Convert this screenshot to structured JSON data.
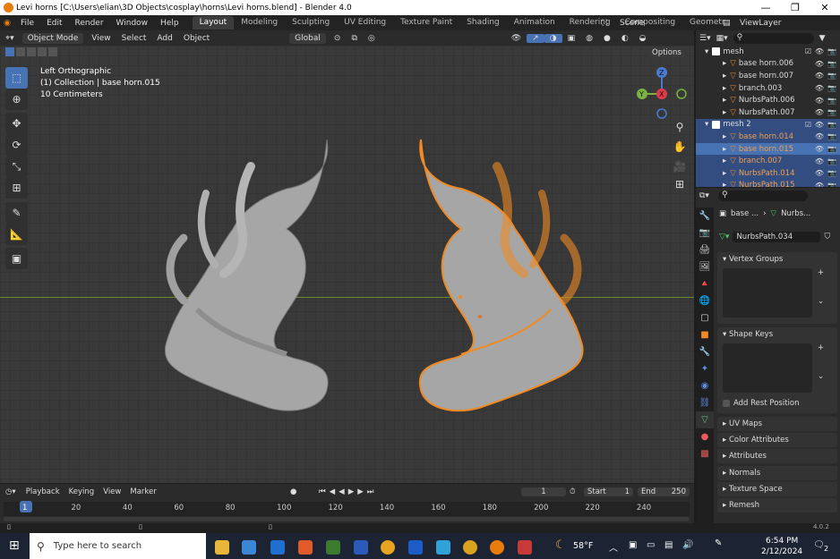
{
  "window": {
    "title": "Levi horns [C:\\Users\\elian\\3D Objects\\cosplay\\horns\\Levi horns.blend] - Blender 4.0"
  },
  "menu": [
    "File",
    "Edit",
    "Render",
    "Window",
    "Help"
  ],
  "workspaces": [
    "Layout",
    "Modeling",
    "Sculpting",
    "UV Editing",
    "Texture Paint",
    "Shading",
    "Animation",
    "Rendering",
    "Compositing",
    "Geometr"
  ],
  "scene": "Scene",
  "view_layer": "ViewLayer",
  "header": {
    "mode": "Object Mode",
    "view": "View",
    "select": "Select",
    "add": "Add",
    "object": "Object",
    "orientation": "Global",
    "options": "Options"
  },
  "viewport": {
    "line1": "Left Orthographic",
    "line2": "(1) Collection | base horn.015",
    "line3": "10 Centimeters"
  },
  "gizmo": {
    "z": "Z",
    "y": "Y",
    "x": "X"
  },
  "outliner": {
    "collections": [
      {
        "name": "mesh",
        "items": [
          "base horn.006",
          "base horn.007",
          "branch.003",
          "NurbsPath.006",
          "NurbsPath.007"
        ]
      },
      {
        "name": "mesh 2",
        "items": [
          "base horn.014",
          "base horn.015",
          "branch.007",
          "NurbsPath.014",
          "NurbsPath.015"
        ]
      }
    ]
  },
  "properties": {
    "breadcrumb1": "base ...",
    "breadcrumb2": "Nurbs...",
    "data_name": "NurbsPath.034",
    "vertex_groups": "Vertex Groups",
    "shape_keys": "Shape Keys",
    "add_rest": "Add Rest Position",
    "sections": [
      "UV Maps",
      "Color Attributes",
      "Attributes",
      "Normals",
      "Texture Space",
      "Remesh"
    ]
  },
  "timeline": {
    "playback": "Playback",
    "keying": "Keying",
    "view": "View",
    "marker": "Marker",
    "current": "1",
    "start_label": "Start",
    "start": "1",
    "end_label": "End",
    "end": "250",
    "ticks": [
      "1",
      "20",
      "40",
      "60",
      "80",
      "100",
      "120",
      "140",
      "160",
      "180",
      "200",
      "220",
      "240"
    ]
  },
  "status": {
    "version": "4.0.2"
  },
  "taskbar": {
    "search": "Type here to search",
    "weather": "58°F",
    "time": "6:54 PM",
    "date": "2/12/2024",
    "notif": "2"
  }
}
